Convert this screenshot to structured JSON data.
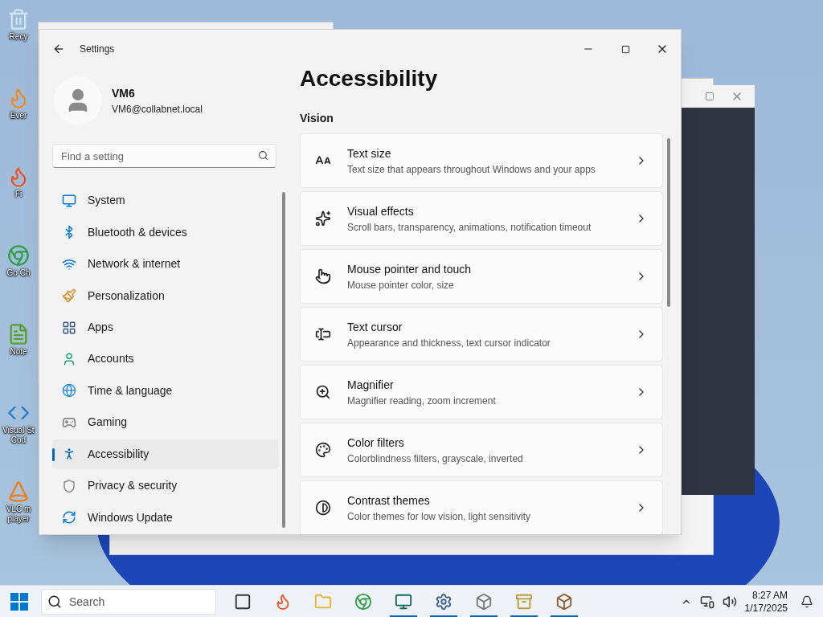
{
  "desktop_icons": [
    {
      "label": "Recy"
    },
    {
      "label": "Ever"
    },
    {
      "label": "Fi"
    },
    {
      "label": "Go Ch"
    },
    {
      "label": "Note"
    },
    {
      "label": "Visual St Cod"
    },
    {
      "label": "VLC m player"
    }
  ],
  "window": {
    "title": "Settings"
  },
  "account": {
    "name": "VM6",
    "email": "VM6@collabnet.local"
  },
  "search": {
    "placeholder": "Find a setting"
  },
  "sidebar": {
    "items": [
      {
        "label": "System",
        "selected": false
      },
      {
        "label": "Bluetooth & devices",
        "selected": false
      },
      {
        "label": "Network & internet",
        "selected": false
      },
      {
        "label": "Personalization",
        "selected": false
      },
      {
        "label": "Apps",
        "selected": false
      },
      {
        "label": "Accounts",
        "selected": false
      },
      {
        "label": "Time & language",
        "selected": false
      },
      {
        "label": "Gaming",
        "selected": false
      },
      {
        "label": "Accessibility",
        "selected": true
      },
      {
        "label": "Privacy & security",
        "selected": false
      },
      {
        "label": "Windows Update",
        "selected": false
      }
    ]
  },
  "page": {
    "title": "Accessibility",
    "section": "Vision",
    "cards": [
      {
        "title": "Text size",
        "description": "Text size that appears throughout Windows and your apps"
      },
      {
        "title": "Visual effects",
        "description": "Scroll bars, transparency, animations, notification timeout"
      },
      {
        "title": "Mouse pointer and touch",
        "description": "Mouse pointer color, size"
      },
      {
        "title": "Text cursor",
        "description": "Appearance and thickness, text cursor indicator"
      },
      {
        "title": "Magnifier",
        "description": "Magnifier reading, zoom increment"
      },
      {
        "title": "Color filters",
        "description": "Colorblindness filters, grayscale, inverted"
      },
      {
        "title": "Contrast themes",
        "description": "Color themes for low vision, light sensitivity"
      }
    ]
  },
  "taskbar": {
    "search_placeholder": "Search",
    "apps": [
      {
        "running": false
      },
      {
        "running": false
      },
      {
        "running": false
      },
      {
        "running": false
      },
      {
        "running": true
      },
      {
        "running": true
      },
      {
        "running": true
      },
      {
        "running": true
      },
      {
        "running": true
      }
    ],
    "time": "8:27 AM",
    "date": "1/17/2025"
  }
}
